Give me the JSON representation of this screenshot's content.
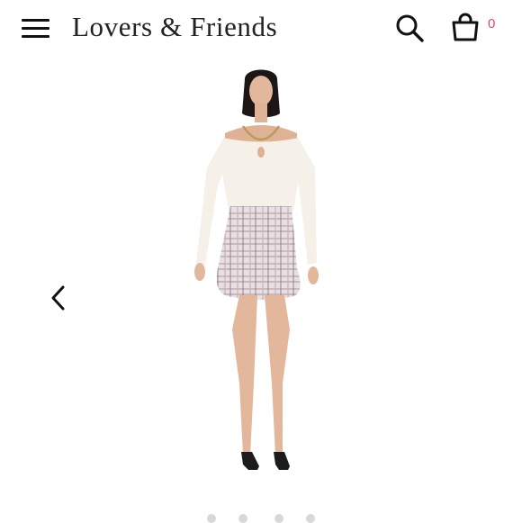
{
  "header": {
    "brand": "Lovers & Friends",
    "cart_count": "0"
  },
  "icons": {
    "menu": "hamburger-menu-icon",
    "search": "search-icon",
    "bag": "shopping-bag-icon",
    "prev": "chevron-left-icon"
  },
  "colors": {
    "text": "#222222",
    "cart_badge": "#d94a6a",
    "background": "#ffffff"
  },
  "carousel": {
    "slide_count": 4,
    "active_index": 0
  }
}
